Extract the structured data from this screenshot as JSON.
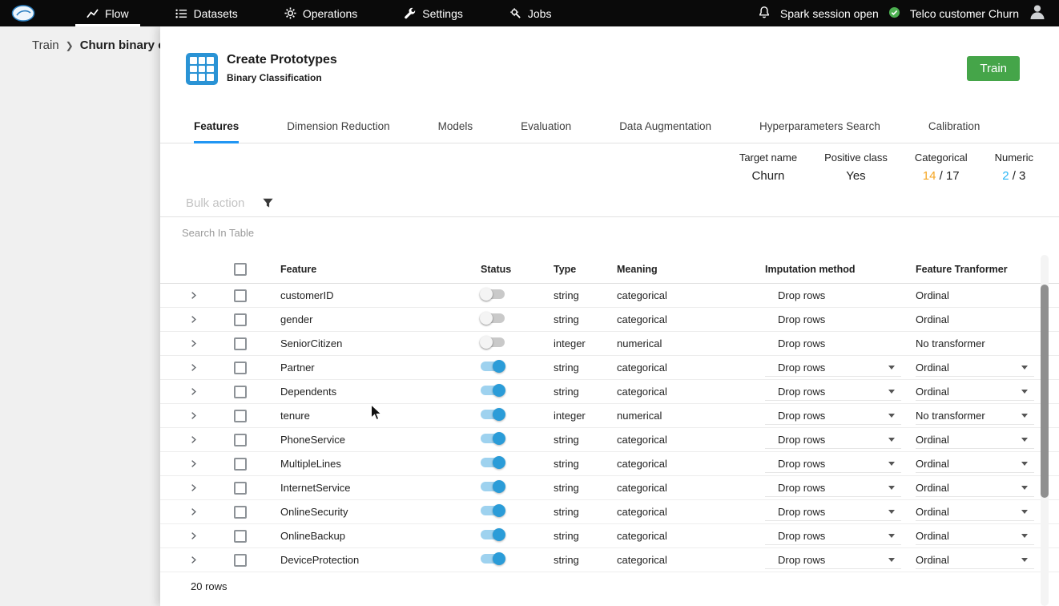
{
  "colors": {
    "accent_blue": "#2196f3",
    "train_green": "#45a549",
    "categorical_orange": "#f5a623",
    "numeric_blue": "#29b6f6",
    "toggle_on": "#2b9cd8"
  },
  "topnav": {
    "items": [
      {
        "id": "flow",
        "label": "Flow"
      },
      {
        "id": "datasets",
        "label": "Datasets"
      },
      {
        "id": "operations",
        "label": "Operations"
      },
      {
        "id": "settings",
        "label": "Settings"
      },
      {
        "id": "jobs",
        "label": "Jobs"
      }
    ],
    "active": "Flow",
    "session_status": "Spark session open",
    "project_name": "Telco customer Churn"
  },
  "breadcrumb": {
    "first": "Train",
    "second": "Churn binary c"
  },
  "header": {
    "title": "Create Prototypes",
    "subtitle": "Binary Classification",
    "train_button": "Train"
  },
  "tabs": {
    "items": [
      "Features",
      "Dimension Reduction",
      "Models",
      "Evaluation",
      "Data Augmentation",
      "Hyperparameters Search",
      "Calibration"
    ],
    "active": "Features"
  },
  "summary": {
    "target": {
      "label": "Target name",
      "value": "Churn"
    },
    "positive": {
      "label": "Positive class",
      "value": "Yes"
    },
    "categorical": {
      "label": "Categorical",
      "count": "14",
      "total": " / 17"
    },
    "numeric": {
      "label": "Numeric",
      "count": "2",
      "total": " / 3"
    }
  },
  "toolbar": {
    "bulk_action_label": "Bulk action"
  },
  "search": {
    "placeholder": "Search In Table"
  },
  "table": {
    "columns": {
      "feature": "Feature",
      "status": "Status",
      "type": "Type",
      "meaning": "Meaning",
      "imputation": "Imputation method",
      "transformer": "Feature Tranformer"
    },
    "rows": [
      {
        "feature": "customerID",
        "enabled": false,
        "type": "string",
        "meaning": "categorical",
        "imputation": "Drop rows",
        "transformer": "Ordinal",
        "editable": false
      },
      {
        "feature": "gender",
        "enabled": false,
        "type": "string",
        "meaning": "categorical",
        "imputation": "Drop rows",
        "transformer": "Ordinal",
        "editable": false
      },
      {
        "feature": "SeniorCitizen",
        "enabled": false,
        "type": "integer",
        "meaning": "numerical",
        "imputation": "Drop rows",
        "transformer": "No transformer",
        "editable": false
      },
      {
        "feature": "Partner",
        "enabled": true,
        "type": "string",
        "meaning": "categorical",
        "imputation": "Drop rows",
        "transformer": "Ordinal",
        "editable": true
      },
      {
        "feature": "Dependents",
        "enabled": true,
        "type": "string",
        "meaning": "categorical",
        "imputation": "Drop rows",
        "transformer": "Ordinal",
        "editable": true
      },
      {
        "feature": "tenure",
        "enabled": true,
        "type": "integer",
        "meaning": "numerical",
        "imputation": "Drop rows",
        "transformer": "No transformer",
        "editable": true
      },
      {
        "feature": "PhoneService",
        "enabled": true,
        "type": "string",
        "meaning": "categorical",
        "imputation": "Drop rows",
        "transformer": "Ordinal",
        "editable": true
      },
      {
        "feature": "MultipleLines",
        "enabled": true,
        "type": "string",
        "meaning": "categorical",
        "imputation": "Drop rows",
        "transformer": "Ordinal",
        "editable": true
      },
      {
        "feature": "InternetService",
        "enabled": true,
        "type": "string",
        "meaning": "categorical",
        "imputation": "Drop rows",
        "transformer": "Ordinal",
        "editable": true
      },
      {
        "feature": "OnlineSecurity",
        "enabled": true,
        "type": "string",
        "meaning": "categorical",
        "imputation": "Drop rows",
        "transformer": "Ordinal",
        "editable": true
      },
      {
        "feature": "OnlineBackup",
        "enabled": true,
        "type": "string",
        "meaning": "categorical",
        "imputation": "Drop rows",
        "transformer": "Ordinal",
        "editable": true
      },
      {
        "feature": "DeviceProtection",
        "enabled": true,
        "type": "string",
        "meaning": "categorical",
        "imputation": "Drop rows",
        "transformer": "Ordinal",
        "editable": true
      }
    ],
    "footer": "20 rows"
  }
}
